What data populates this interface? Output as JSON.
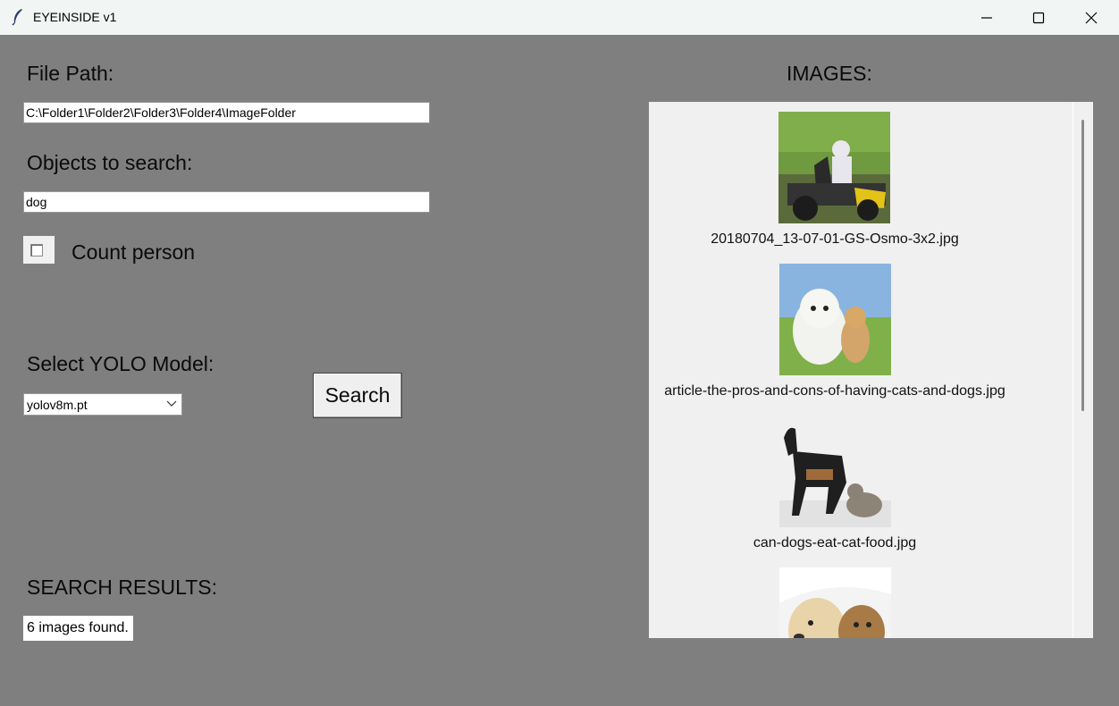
{
  "window": {
    "title": "EYEINSIDE v1",
    "controls": {
      "minimize": "minimize-icon",
      "maximize": "maximize-icon",
      "close": "close-icon"
    }
  },
  "form": {
    "file_path_label": "File Path:",
    "file_path_value": "C:\\Folder1\\Folder2\\Folder3\\Folder4\\ImageFolder",
    "objects_label": "Objects to search:",
    "objects_value": "dog",
    "count_person_label": "Count person",
    "count_person_checked": false,
    "model_label": "Select YOLO Model:",
    "model_selected": "yolov8m.pt",
    "search_button": "Search"
  },
  "results": {
    "label": "SEARCH RESULTS:",
    "summary": "6 images found."
  },
  "images": {
    "label": "IMAGES:",
    "items": [
      {
        "filename": "20180704_13-07-01-GS-Osmo-3x2.jpg"
      },
      {
        "filename": "article-the-pros-and-cons-of-having-cats-and-dogs.jpg"
      },
      {
        "filename": "can-dogs-eat-cat-food.jpg"
      },
      {
        "filename": ""
      }
    ]
  },
  "colors": {
    "window_bg": "#7f7f7f",
    "titlebar_bg": "#f1f6f4",
    "panel_bg": "#f0f0f0"
  }
}
